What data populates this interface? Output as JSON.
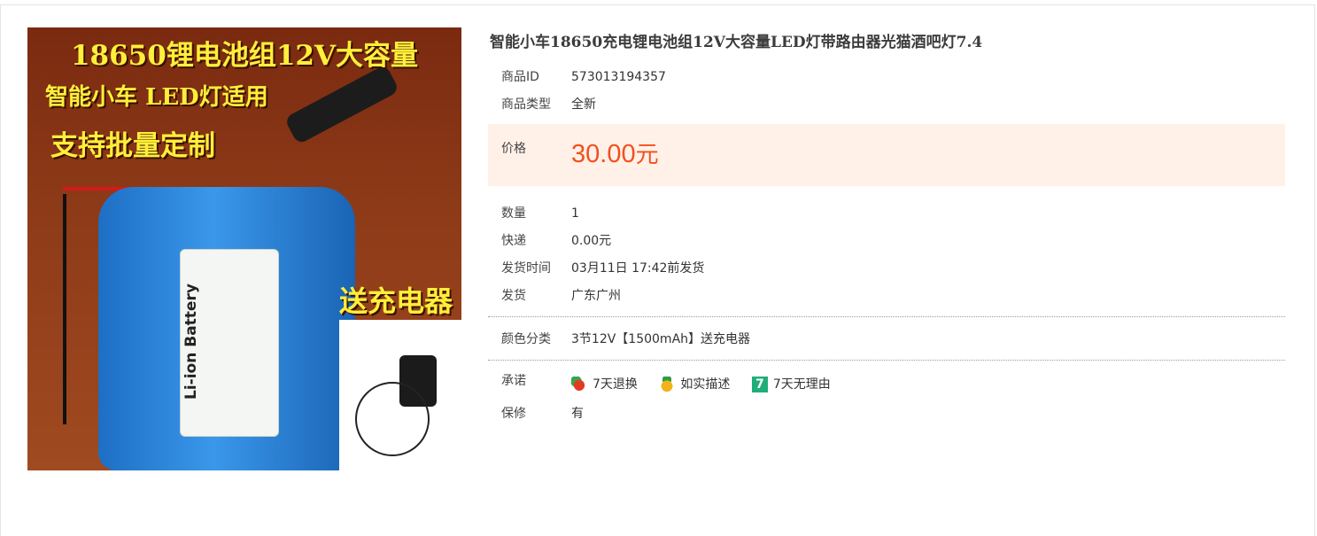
{
  "product": {
    "title": "智能小车18650充电锂电池组12V大容量LED灯带路由器光猫酒吧灯7.4",
    "image_text": {
      "line1": "18650锂电池组12V大容量",
      "line2": "智能小车 LED灯适用",
      "line3": "支持批量定制",
      "line4": "送充电器",
      "battery_label": "Li-ion Battery"
    },
    "id_label": "商品ID",
    "id_value": "573013194357",
    "type_label": "商品类型",
    "type_value": "全新",
    "price_label": "价格",
    "price_value": "30.00",
    "price_unit": "元",
    "qty_label": "数量",
    "qty_value": "1",
    "shipping_label": "快递",
    "shipping_value": "0.00元",
    "ship_time_label": "发货时间",
    "ship_time_value": "03月11日 17:42前发货",
    "origin_label": "发货",
    "origin_value": "广东广州",
    "color_label": "颜色分类",
    "color_value": "3节12V【1500mAh】送充电器",
    "promise_label": "承诺",
    "promises": [
      "7天退换",
      "如实描述",
      "7天无理由"
    ],
    "seven_glyph": "7",
    "warranty_label": "保修",
    "warranty_value": "有"
  },
  "colors": {
    "price": "#f2501f",
    "price_bg": "#fff1e8"
  },
  "icons": [
    "return-icon",
    "accurate-description-icon",
    "seven-days-no-reason-icon"
  ]
}
